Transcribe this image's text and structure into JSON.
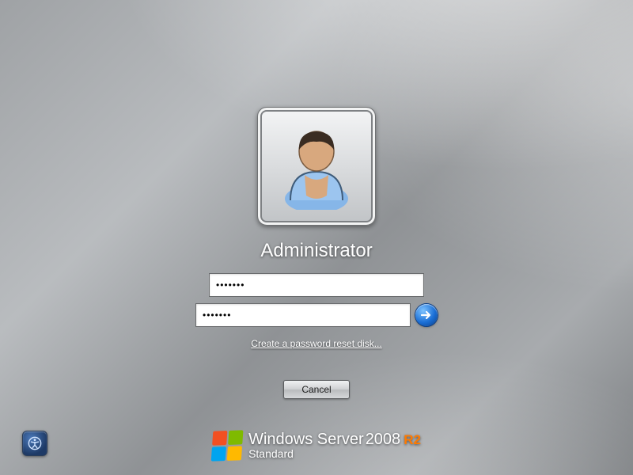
{
  "user": {
    "name": "Administrator",
    "password1_masked": "•••••••",
    "password2_masked": "•••••••"
  },
  "links": {
    "reset": "Create a password reset disk..."
  },
  "buttons": {
    "cancel": "Cancel"
  },
  "branding": {
    "product": "Windows Server",
    "year": "2008",
    "suffix": "R2",
    "edition": "Standard"
  },
  "flag_colors": {
    "tl": "#f25022",
    "tr": "#7fba00",
    "bl": "#00a4ef",
    "br": "#ffb900"
  }
}
